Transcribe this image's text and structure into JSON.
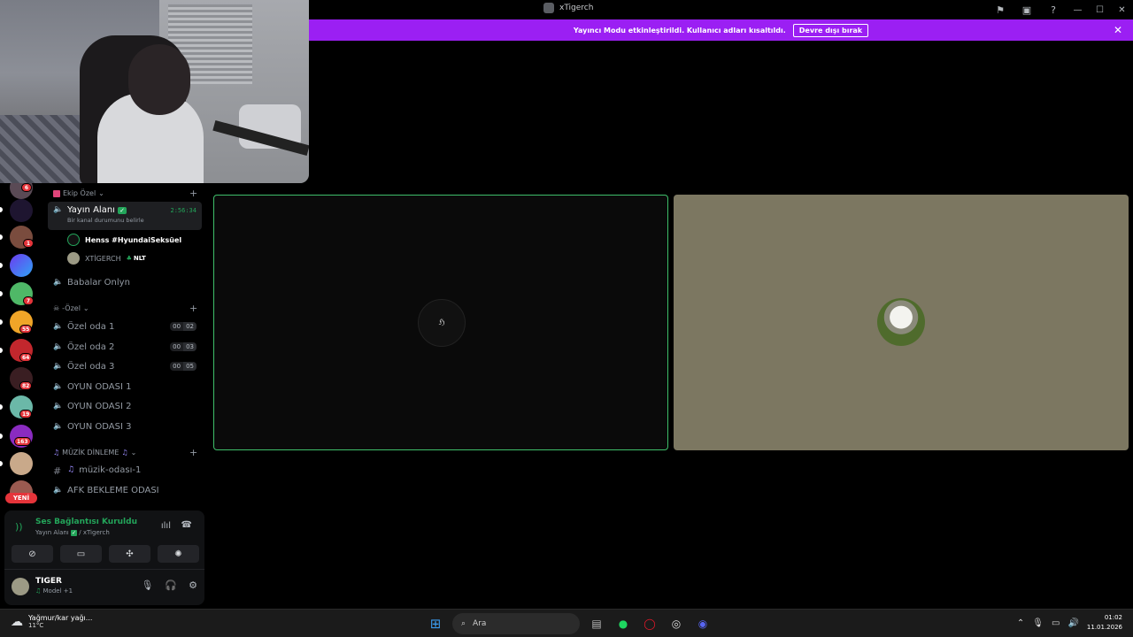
{
  "window": {
    "title": "xTigerch"
  },
  "banner": {
    "text": "Yayıncı Modu etkinleştirildi. Kullanıcı adları kısaltıldı.",
    "button_label": "Devre dışı bırak"
  },
  "servers": {
    "badges": [
      "6",
      "1",
      "7",
      "55",
      "64",
      "82",
      "19",
      "163"
    ],
    "new_label": "YENİ"
  },
  "channels": {
    "category_1": "Ekip Özel",
    "active_channel": "Yayın Alanı",
    "active_status": "Bir kanal durumunu belirle",
    "active_timer": "2:56:34",
    "users": [
      {
        "name": "Henss #HyundaiSeksüel",
        "tag": ""
      },
      {
        "name": "XTİGERCH",
        "tag": "NLT"
      }
    ],
    "babalar": "Babalar Onlyn",
    "category_2": "-Özel",
    "ozel_rooms": [
      {
        "name": "Özel oda 1",
        "a": "00",
        "b": "02"
      },
      {
        "name": "Özel oda 2",
        "a": "00",
        "b": "03"
      },
      {
        "name": "Özel oda 3",
        "a": "00",
        "b": "05"
      }
    ],
    "oyun_rooms": [
      "OYUN ODASI 1",
      "OYUN ODASI 2",
      "OYUN ODASI 3"
    ],
    "category_3": "MÜZİK DİNLEME",
    "text_channel": "müzik-odası-1",
    "afk": "AFK BEKLEME ODASI"
  },
  "voice_panel": {
    "status": "Ses Bağlantısı Kuruldu",
    "channel_prefix": "Yayın Alanı",
    "channel_suffix": "/ xTigerch"
  },
  "user_panel": {
    "name": "TIGER",
    "status": "Model +1"
  },
  "taskbar": {
    "weather_title": "Yağmur/kar yağı...",
    "weather_temp": "11°C",
    "search_placeholder": "Ara",
    "time": "01:02",
    "date": "11.01.2026"
  },
  "colors": {
    "banner": "#9b1ff3",
    "speaking_border": "#3fbf6a",
    "connected_green": "#23a55a",
    "badge_red": "#e5343a"
  }
}
